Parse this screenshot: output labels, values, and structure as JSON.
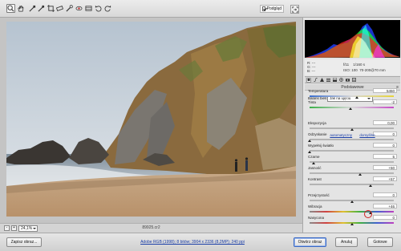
{
  "toolbar": {
    "tools": [
      {
        "icon": "zoom-icon",
        "active": true
      },
      {
        "icon": "hand-icon",
        "active": false
      },
      {
        "icon": "white-balance-icon",
        "active": false
      },
      {
        "icon": "color-sampler-icon",
        "active": false
      },
      {
        "icon": "crop-icon",
        "active": false
      },
      {
        "icon": "straighten-icon",
        "active": false
      },
      {
        "icon": "spot-removal-icon",
        "active": false
      },
      {
        "icon": "red-eye-icon",
        "active": false
      },
      {
        "icon": "preferences-icon",
        "active": false
      },
      {
        "icon": "rotate-left-icon",
        "active": false
      },
      {
        "icon": "rotate-right-icon",
        "active": false
      }
    ],
    "preview_label": "Podgląd",
    "preview_checked": true
  },
  "canvas": {
    "zoom_value": "24,1%",
    "zoom_minus": "-",
    "zoom_plus": "+",
    "filename": "89925.cr2"
  },
  "histogram": {
    "colors": [
      "#ff2020",
      "#20ff20",
      "#2040ff",
      "#ffff30",
      "#20ffff",
      "#ff30ff",
      "#ffffff"
    ]
  },
  "camera_info": {
    "r_label": "R:",
    "r_value": "---",
    "g_label": "G:",
    "g_value": "---",
    "b_label": "B:",
    "b_value": "---",
    "aperture": "f/11",
    "shutter": "1/160 s",
    "iso": "ISO: 100",
    "lens": "70-200@70 mm"
  },
  "panel": {
    "section_title": "Podstawowe",
    "menu_icon": "≡",
    "white_balance_label": "Balans bieli:",
    "white_balance_value": "Jak na ujęciu",
    "auto_link": "automatyczny",
    "default_link": "domyślne",
    "sliders": [
      {
        "label": "Temperatura",
        "value": "5450",
        "fraction": 0.56,
        "track": "temp"
      },
      {
        "label": "Tinta",
        "value": "-2",
        "fraction": 0.49,
        "track": "tint"
      },
      {
        "label": "Ekspozycja",
        "value": "0,00",
        "fraction": 0.5,
        "track": "plain"
      },
      {
        "label": "Odzyskanie",
        "value": "0",
        "fraction": 0.0,
        "track": "plain"
      },
      {
        "label": "Wypełnij światło",
        "value": "0",
        "fraction": 0.0,
        "track": "plain"
      },
      {
        "label": "Czarne",
        "value": "5",
        "fraction": 0.05,
        "track": "plain"
      },
      {
        "label": "Jasność",
        "value": "+50",
        "fraction": 0.6,
        "track": "plain"
      },
      {
        "label": "Kontrast",
        "value": "+57",
        "fraction": 0.72,
        "track": "plain"
      },
      {
        "label": "Przejrzystość",
        "value": "0",
        "fraction": 0.5,
        "track": "plain"
      },
      {
        "label": "Wibracja",
        "value": "+46",
        "fraction": 0.72,
        "track": "sat"
      },
      {
        "label": "Nasycona",
        "value": "0",
        "fraction": 0.5,
        "track": "sat"
      }
    ]
  },
  "bottom": {
    "save_label": "Zapisz obraz...",
    "workflow_link": "Adobe RGB (1998); 8 bitów; 3904 x 2336 (8,2MP); 240 ppi",
    "open_label": "Otwórz obraz",
    "cancel_label": "Anuluj",
    "done_label": "Gotowe"
  }
}
